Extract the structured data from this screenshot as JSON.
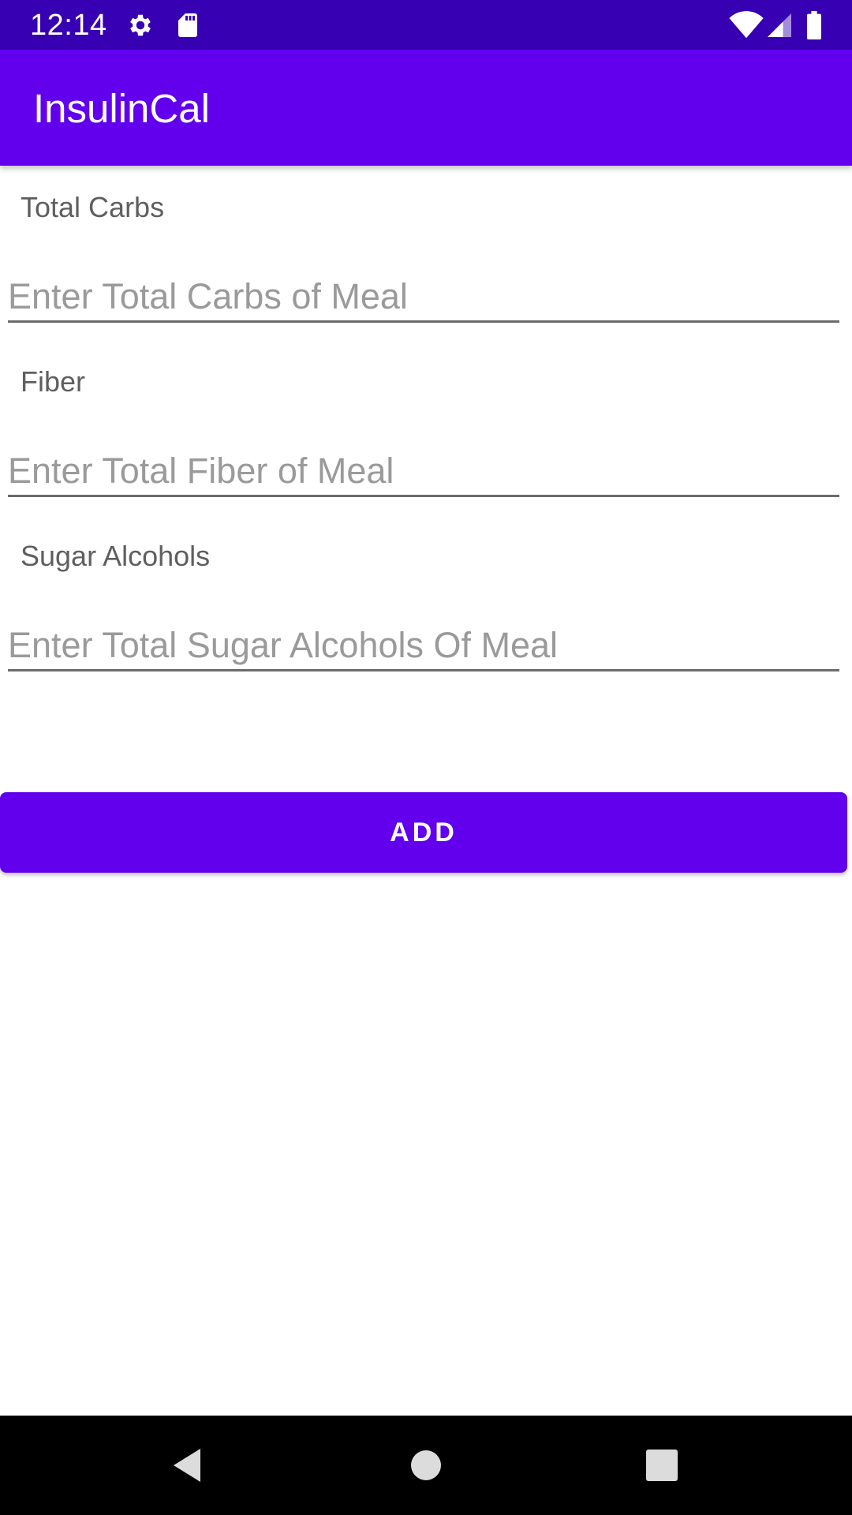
{
  "status_bar": {
    "time": "12:14",
    "icons": [
      "gear-icon",
      "sd-card-icon",
      "wifi-icon",
      "cell-signal-icon",
      "battery-icon"
    ]
  },
  "app_bar": {
    "title": "InsulinCal"
  },
  "form": {
    "fields": [
      {
        "label": "Total Carbs",
        "placeholder": "Enter Total Carbs of Meal",
        "value": ""
      },
      {
        "label": "Fiber",
        "placeholder": "Enter Total Fiber of Meal",
        "value": ""
      },
      {
        "label": "Sugar Alcohols",
        "placeholder": "Enter Total Sugar Alcohols Of Meal",
        "value": ""
      }
    ],
    "add_label": "ADD"
  },
  "nav_bar": {
    "icons": [
      "back-icon",
      "home-icon",
      "recents-icon"
    ]
  },
  "colors": {
    "primary": "#6200EE",
    "primary_dark": "#3700B3",
    "nav_bar": "#000000"
  }
}
